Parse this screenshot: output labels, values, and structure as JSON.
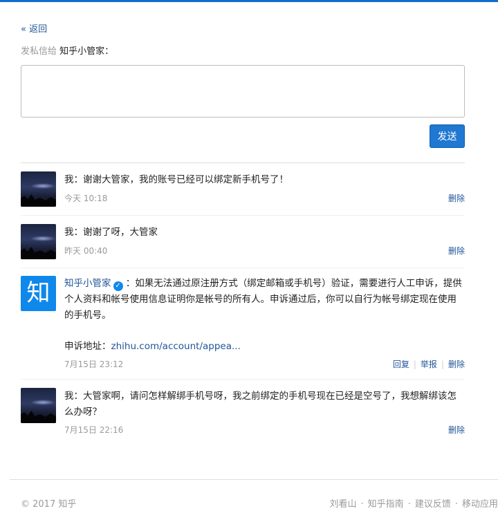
{
  "nav": {
    "back_label": "« 返回"
  },
  "compose": {
    "prefix": "发私信给",
    "recipient": "知乎小管家",
    "suffix": "：",
    "placeholder": "",
    "send_label": "发送"
  },
  "colors": {
    "accent": "#0f88eb",
    "link": "#225599",
    "button": "#1f78d1"
  },
  "messages": [
    {
      "sender": "我",
      "separator": "：",
      "text": "谢谢大管家，我的账号已经可以绑定新手机号了！",
      "time": "今天 10:18",
      "delete_label": "删除",
      "avatar": "night-sky-avatar"
    },
    {
      "sender": "我",
      "separator": "：",
      "text": "谢谢了呀，大管家",
      "time": "昨天 00:40",
      "delete_label": "删除",
      "avatar": "night-sky-avatar"
    },
    {
      "sender": "知乎小管家",
      "verified_icon": "verified-check-icon",
      "separator": "：",
      "text": "如果无法通过原注册方式（绑定邮箱或手机号）验证，需要进行人工申诉，提供个人资料和帐号使用信息证明你是帐号的所有人。申诉通过后，你可以自行为帐号绑定现在使用的手机号。",
      "appeal_label": "申诉地址：",
      "appeal_url": "zhihu.com/account/appea...",
      "time": "7月15日 23:12",
      "reply_label": "回复",
      "report_label": "举报",
      "delete_label": "删除",
      "avatar": "知"
    },
    {
      "sender": "我",
      "separator": "：",
      "text": "大管家啊，请问怎样解绑手机号呀，我之前绑定的手机号现在已经是空号了，我想解绑该怎么办呀？",
      "time": "7月15日 22:16",
      "delete_label": "删除",
      "avatar": "night-sky-avatar"
    }
  ],
  "footer": {
    "copyright": "© 2017 知乎",
    "links": [
      "刘看山",
      "知乎指南",
      "建议反馈",
      "移动应用"
    ],
    "separator": "·"
  }
}
